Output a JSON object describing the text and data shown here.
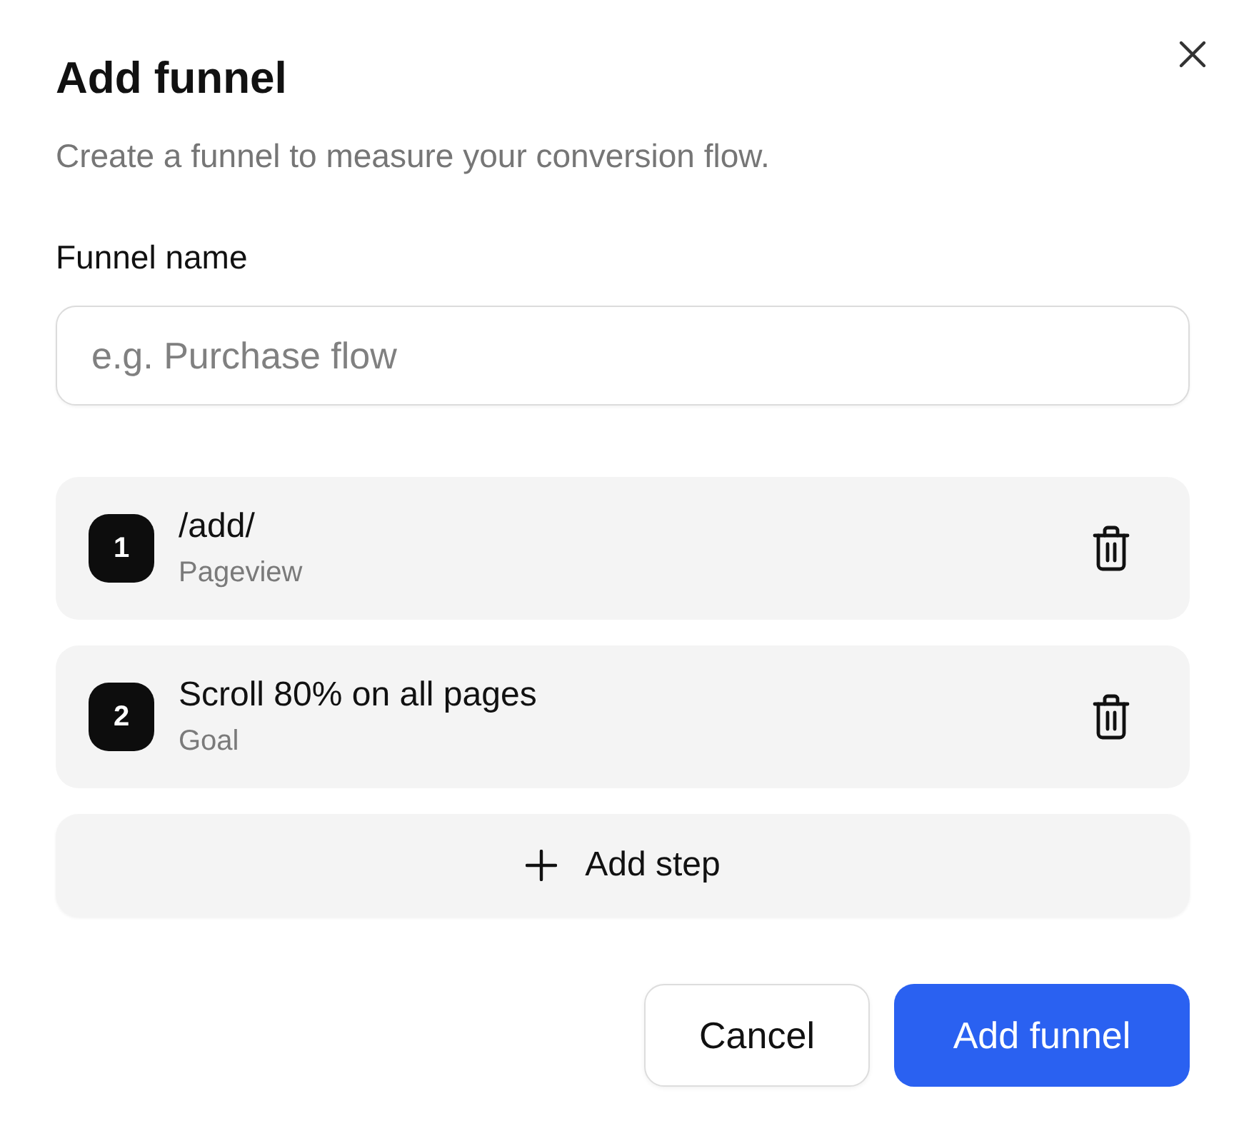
{
  "dialog": {
    "title": "Add funnel",
    "description": "Create a funnel to measure your conversion flow."
  },
  "name_field": {
    "label": "Funnel name",
    "placeholder": "e.g. Purchase flow"
  },
  "steps": [
    {
      "number": "1",
      "name": "/add/",
      "type": "Pageview"
    },
    {
      "number": "2",
      "name": "Scroll 80% on all pages",
      "type": "Goal"
    }
  ],
  "add_step": {
    "label": "Add step"
  },
  "buttons": [
    {
      "kind": "secondary",
      "label": "Cancel"
    },
    {
      "kind": "primary",
      "label": "Add funnel"
    }
  ]
}
